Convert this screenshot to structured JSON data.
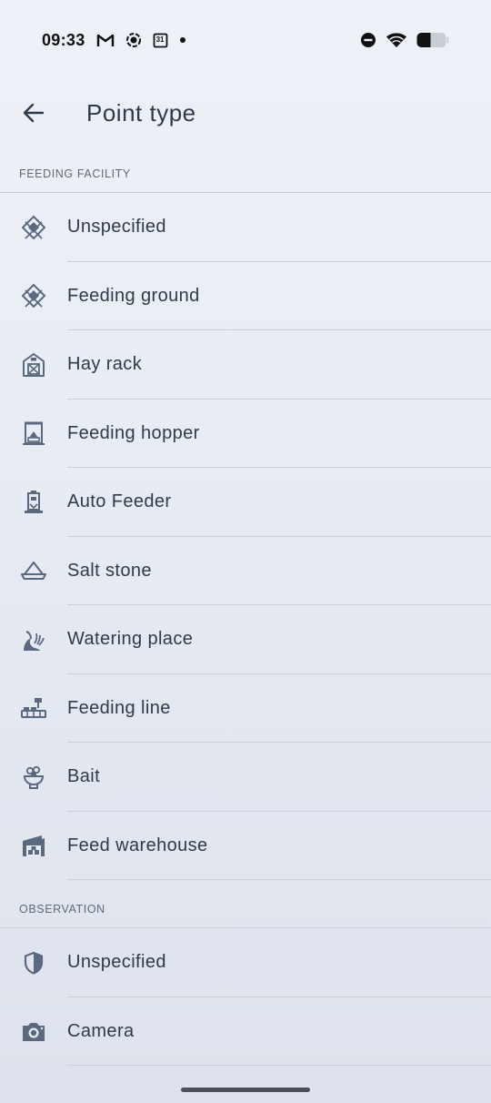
{
  "status_bar": {
    "time": "09:33",
    "calendar_day": "31",
    "left_icons": [
      "gmail-icon",
      "record-icon",
      "calendar-icon",
      "dot-icon"
    ],
    "right_icons": [
      "do-not-disturb-icon",
      "wifi-icon",
      "battery-icon"
    ]
  },
  "app_bar": {
    "title": "Point type"
  },
  "sections": [
    {
      "header": "FEEDING FACILITY",
      "items": [
        {
          "label": "Unspecified",
          "icon": "feeding-diamond-icon"
        },
        {
          "label": "Feeding ground",
          "icon": "feeding-diamond-icon"
        },
        {
          "label": "Hay rack",
          "icon": "barn-icon"
        },
        {
          "label": "Feeding hopper",
          "icon": "hopper-icon"
        },
        {
          "label": "Auto Feeder",
          "icon": "auto-feeder-icon"
        },
        {
          "label": "Salt stone",
          "icon": "salt-stone-icon"
        },
        {
          "label": "Watering place",
          "icon": "watering-icon"
        },
        {
          "label": "Feeding line",
          "icon": "feeding-line-icon"
        },
        {
          "label": "Bait",
          "icon": "bait-icon"
        },
        {
          "label": "Feed warehouse",
          "icon": "warehouse-icon"
        }
      ]
    },
    {
      "header": "OBSERVATION",
      "items": [
        {
          "label": "Unspecified",
          "icon": "shield-icon"
        },
        {
          "label": "Camera",
          "icon": "camera-icon"
        }
      ]
    }
  ],
  "colors": {
    "text": "#2f3a4a",
    "icon": "#5a6880",
    "divider": "#c9cfd9",
    "section_header": "#5f6a7a"
  }
}
